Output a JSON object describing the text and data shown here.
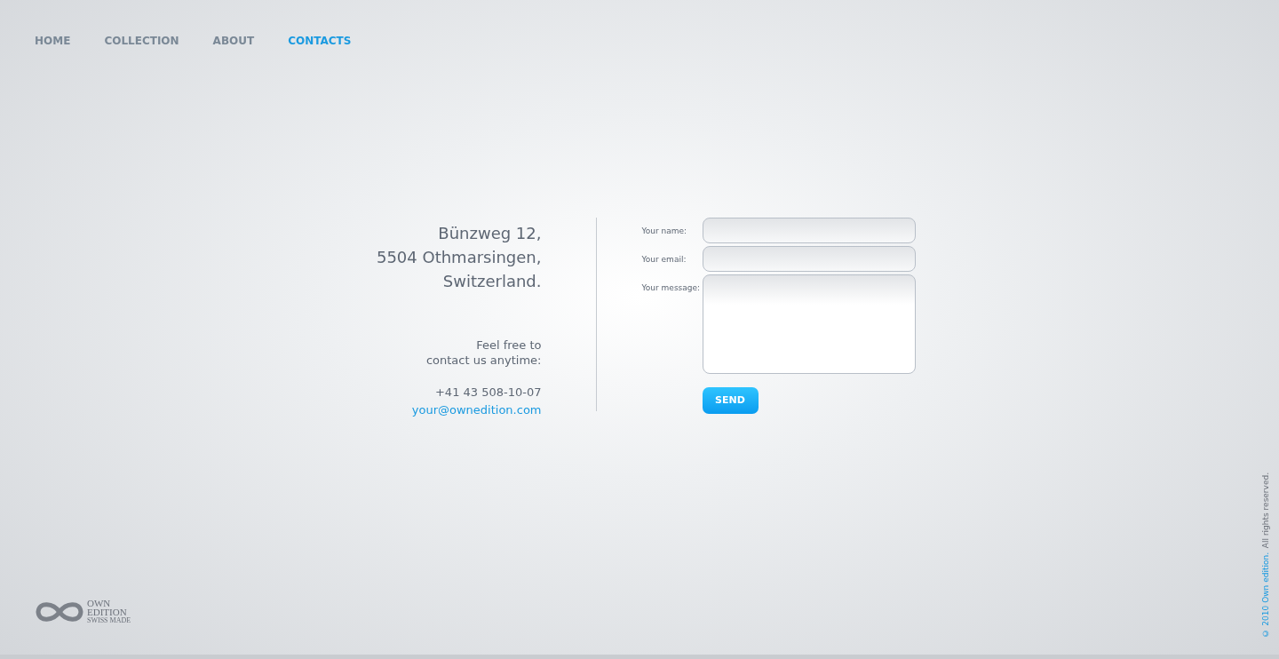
{
  "nav": [
    {
      "label": "HOME",
      "selected": false
    },
    {
      "label": "COLLECTION",
      "selected": false
    },
    {
      "label": "ABOUT",
      "selected": false
    },
    {
      "label": "CONTACTS",
      "selected": true
    }
  ],
  "address": [
    "Bünzweg 12,",
    "5504 Othmarsingen,",
    "Switzerland."
  ],
  "invite": [
    "Feel free to",
    "contact us anytime:"
  ],
  "phone": "+41 43 508-10-07",
  "email": "your@ownedition.com",
  "form": {
    "fields": [
      {
        "label": "Your name:",
        "kind": "input"
      },
      {
        "label": "Your email:",
        "kind": "input"
      },
      {
        "label": "Your message:",
        "kind": "textarea"
      }
    ],
    "submit": "SEND"
  },
  "logo": {
    "lines": [
      "OWN",
      "EDITION",
      "SWISS MADE"
    ]
  },
  "footer": {
    "copyright": "© 2010 Own edition.",
    "rights": "All rights reserved."
  }
}
